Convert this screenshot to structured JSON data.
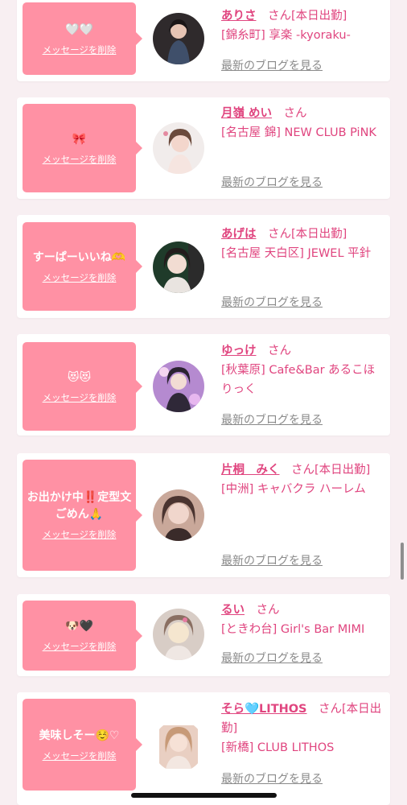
{
  "delete_label": "メッセージを削除",
  "blog_label": "最新のブログを見る",
  "accent_color": "#e0457f",
  "bubble_color": "#ff91a4",
  "messages": [
    {
      "message": "🤍🤍",
      "name": "ありさ",
      "suffix": "　さん[本日出勤]",
      "shop": "[錦糸町] 享楽 -kyoraku-"
    },
    {
      "message": "🎀",
      "name": "月嶺 めい",
      "suffix": "　さん",
      "shop": "[名古屋 錦] NEW CLUB PiNK"
    },
    {
      "message": "すーぱーいいね🫶",
      "name": "あげは",
      "suffix": "　さん[本日出勤]",
      "shop": "[名古屋 天白区] JEWEL 平針"
    },
    {
      "message": "😻😻",
      "name": "ゆっけ",
      "suffix": "　さん",
      "shop": "[秋葉原] Cafe&Bar あるこほりっく"
    },
    {
      "message": "お出かけ中‼️定型文ごめん🙏",
      "name": "片桐　みく",
      "suffix": "　さん[本日出勤]",
      "shop": "[中洲] キャバクラ ハーレム"
    },
    {
      "message": "🐶🖤",
      "name": "るい",
      "suffix": "　さん",
      "shop": "[ときわ台] Girl's Bar MIMI"
    },
    {
      "message": "美味しそー☺️♡",
      "name": "そら🩵LITHOS",
      "suffix": "　さん[本日出勤]",
      "shop": "[新橋] CLUB LITHOS"
    }
  ]
}
